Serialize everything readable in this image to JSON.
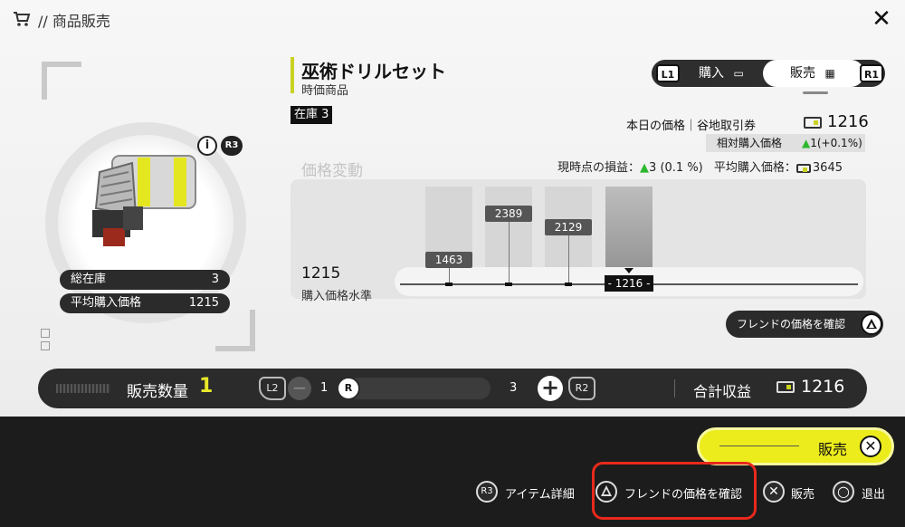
{
  "header": {
    "title": "// 商品販売",
    "cart_icon": "cart-icon",
    "close_icon": "close-icon",
    "close_glyph": "✕"
  },
  "item": {
    "name": "巫術ドリルセット",
    "subtitle": "時価商品",
    "stock_tag_label": "在庫",
    "stock_tag_value": "3",
    "info_glyph": "i",
    "r3_label": "R3",
    "stats": [
      {
        "label": "総在庫",
        "value": "3"
      },
      {
        "label": "平均購入価格",
        "value": "1215"
      }
    ]
  },
  "tabs": {
    "l1": "L1",
    "buy": "購入",
    "sell": "販売",
    "r1": "R1"
  },
  "pricing": {
    "today_label": "本日の価格｜谷地取引券",
    "today_value": "1216",
    "relative_label": "相対購入価格",
    "relative_value_up": "▲",
    "relative_value": "1(+0.1%)",
    "chart_title": "価格変動",
    "pl_label": "現時点の損益：",
    "pl_up": "▲",
    "pl_value": "3",
    "pl_pct": "(0.1 %)",
    "avg_label": "平均購入価格：",
    "avg_value": "3645",
    "accent_color": "#c9d21f",
    "up_color": "#2eb82e"
  },
  "chart_data": {
    "type": "bar",
    "baseline_value": "1215",
    "baseline_label": "購入価格水準",
    "points": [
      {
        "label": "1463",
        "value": 1463
      },
      {
        "label": "2389",
        "value": 2389
      },
      {
        "label": "2129",
        "value": 2129
      },
      {
        "label": "- 1216 -",
        "value": 1216,
        "current": true
      }
    ]
  },
  "friend": {
    "button_label": "フレンドの価格を確認",
    "icon": "triangle-icon"
  },
  "quantity": {
    "label": "販売数量",
    "value": "1",
    "l2": "L2",
    "r2": "R2",
    "minus": "−",
    "plus": "+",
    "min": "1",
    "max": "3",
    "knob": "R",
    "total_label": "合計収益",
    "total_value": "1216"
  },
  "actions": {
    "sell_label": "販売",
    "sell_glyph": "✕",
    "hints": [
      {
        "icon": "R3",
        "label": "アイテム詳細"
      },
      {
        "icon": "triangle",
        "label": "フレンドの価格を確認"
      },
      {
        "icon": "✕",
        "label": "販売"
      },
      {
        "icon": "○",
        "label": "退出"
      }
    ]
  }
}
